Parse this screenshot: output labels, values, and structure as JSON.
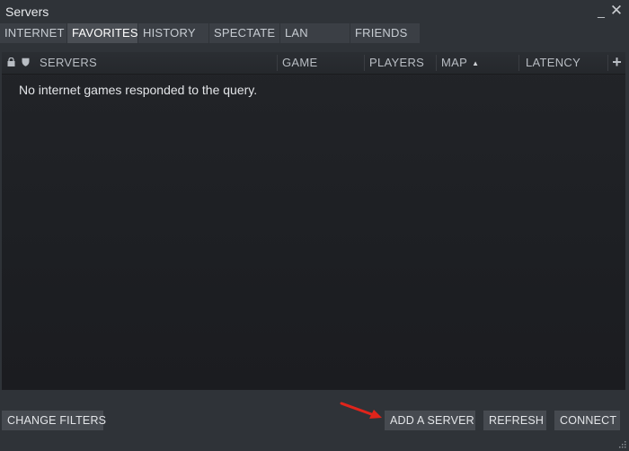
{
  "window": {
    "title": "Servers"
  },
  "tabs": [
    {
      "label": "INTERNET",
      "active": false
    },
    {
      "label": "FAVORITES",
      "active": true
    },
    {
      "label": "HISTORY",
      "active": false
    },
    {
      "label": "SPECTATE",
      "active": false
    },
    {
      "label": "LAN",
      "active": false
    },
    {
      "label": "FRIENDS",
      "active": false
    }
  ],
  "table": {
    "columns": {
      "servers": "SERVERS",
      "game": "GAME",
      "players": "PLAYERS",
      "map": "MAP",
      "latency": "LATENCY"
    },
    "sorted_by": "MAP",
    "empty_message": "No internet games responded to the query."
  },
  "footer": {
    "change_filters": "CHANGE FILTERS",
    "add_server": "ADD A SERVER",
    "refresh": "REFRESH",
    "connect": "CONNECT"
  },
  "colors": {
    "background": "#2f3338",
    "list_background": "#1d1f23",
    "active_tab": "#4a4e54",
    "button": "#464a50",
    "annotation_arrow": "#e0241b"
  },
  "icons": [
    "minimize-icon",
    "close-icon",
    "lock-icon",
    "shield-icon",
    "sort-up-icon",
    "add-column-icon",
    "resize-grip-icon"
  ]
}
